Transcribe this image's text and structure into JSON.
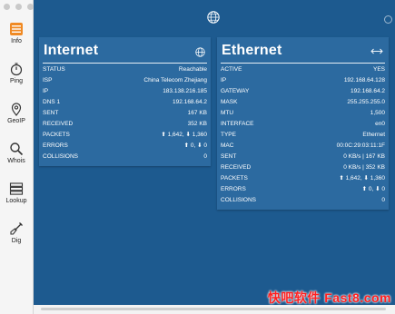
{
  "sidebar": {
    "items": [
      {
        "label": "Info",
        "active": true
      },
      {
        "label": "Ping"
      },
      {
        "label": "GeoIP"
      },
      {
        "label": "Whois"
      },
      {
        "label": "Lookup"
      },
      {
        "label": "Dig"
      }
    ]
  },
  "colors": {
    "background": "#1d5a8f",
    "panel": "#2c6aa0",
    "accent": "#f08a24"
  },
  "internet": {
    "title": "Internet",
    "rows": [
      {
        "key": "STATUS",
        "value": "Reachable"
      },
      {
        "key": "ISP",
        "value": "China Telecom Zhejiang"
      },
      {
        "key": "IP",
        "value": "183.138.216.185"
      },
      {
        "key": "DNS 1",
        "value": "192.168.64.2"
      },
      {
        "key": "SENT",
        "value": "167 KB"
      },
      {
        "key": "RECEIVED",
        "value": "352 KB"
      },
      {
        "key": "PACKETS",
        "value": "⬆ 1,642, ⬇ 1,360"
      },
      {
        "key": "ERRORS",
        "value": "⬆ 0, ⬇ 0"
      },
      {
        "key": "COLLISIONS",
        "value": "0"
      }
    ]
  },
  "ethernet": {
    "title": "Ethernet",
    "rows": [
      {
        "key": "ACTIVE",
        "value": "YES"
      },
      {
        "key": "IP",
        "value": "192.168.64.128"
      },
      {
        "key": "GATEWAY",
        "value": "192.168.64.2"
      },
      {
        "key": "MASK",
        "value": "255.255.255.0"
      },
      {
        "key": "MTU",
        "value": "1,500"
      },
      {
        "key": "INTERFACE",
        "value": "en0"
      },
      {
        "key": "TYPE",
        "value": "Ethernet"
      },
      {
        "key": "MAC",
        "value": "00:0C:29:03:11:1F"
      },
      {
        "key": "SENT",
        "value": "0 KB/s | 167 KB"
      },
      {
        "key": "RECEIVED",
        "value": "0 KB/s | 352 KB"
      },
      {
        "key": "PACKETS",
        "value": "⬆ 1,642, ⬇ 1,360"
      },
      {
        "key": "ERRORS",
        "value": "⬆ 0, ⬇ 0"
      },
      {
        "key": "COLLISIONS",
        "value": "0"
      }
    ]
  },
  "watermark": {
    "text": "快吧软件 Fast8.com"
  }
}
